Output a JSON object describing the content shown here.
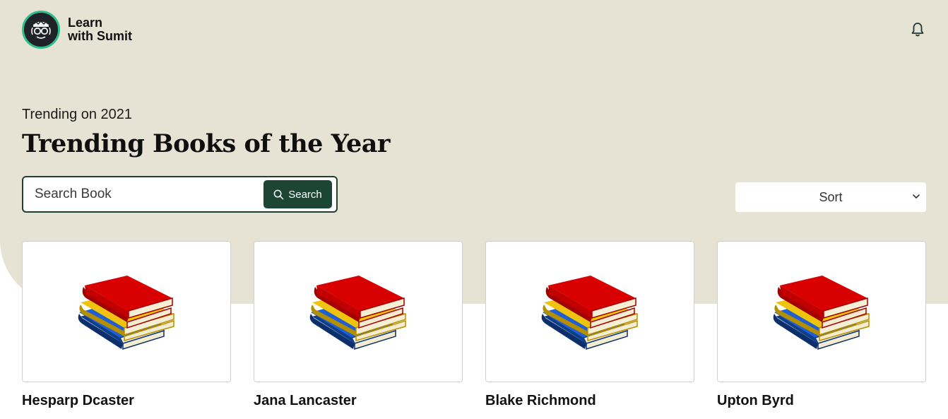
{
  "brand": {
    "line1": "Learn",
    "line2": "with Sumit"
  },
  "icons": {
    "logo": "glasses-face-icon",
    "notifications": "bell-icon",
    "search": "search-icon",
    "sort": "chevron-down-icon",
    "book": "book-stack-icon"
  },
  "colors": {
    "hero_bg": "#e7e3d4",
    "accent": "#1d4535",
    "logo_ring": "#2fbf8b"
  },
  "hero": {
    "eyebrow": "Trending on 2021",
    "title": "Trending Books of the Year"
  },
  "search": {
    "placeholder": "Search Book",
    "value": "",
    "button_label": "Search"
  },
  "sort": {
    "selected": "Sort"
  },
  "books": [
    {
      "title": "Hesparp Dcaster"
    },
    {
      "title": "Jana Lancaster"
    },
    {
      "title": "Blake Richmond"
    },
    {
      "title": "Upton Byrd"
    }
  ]
}
